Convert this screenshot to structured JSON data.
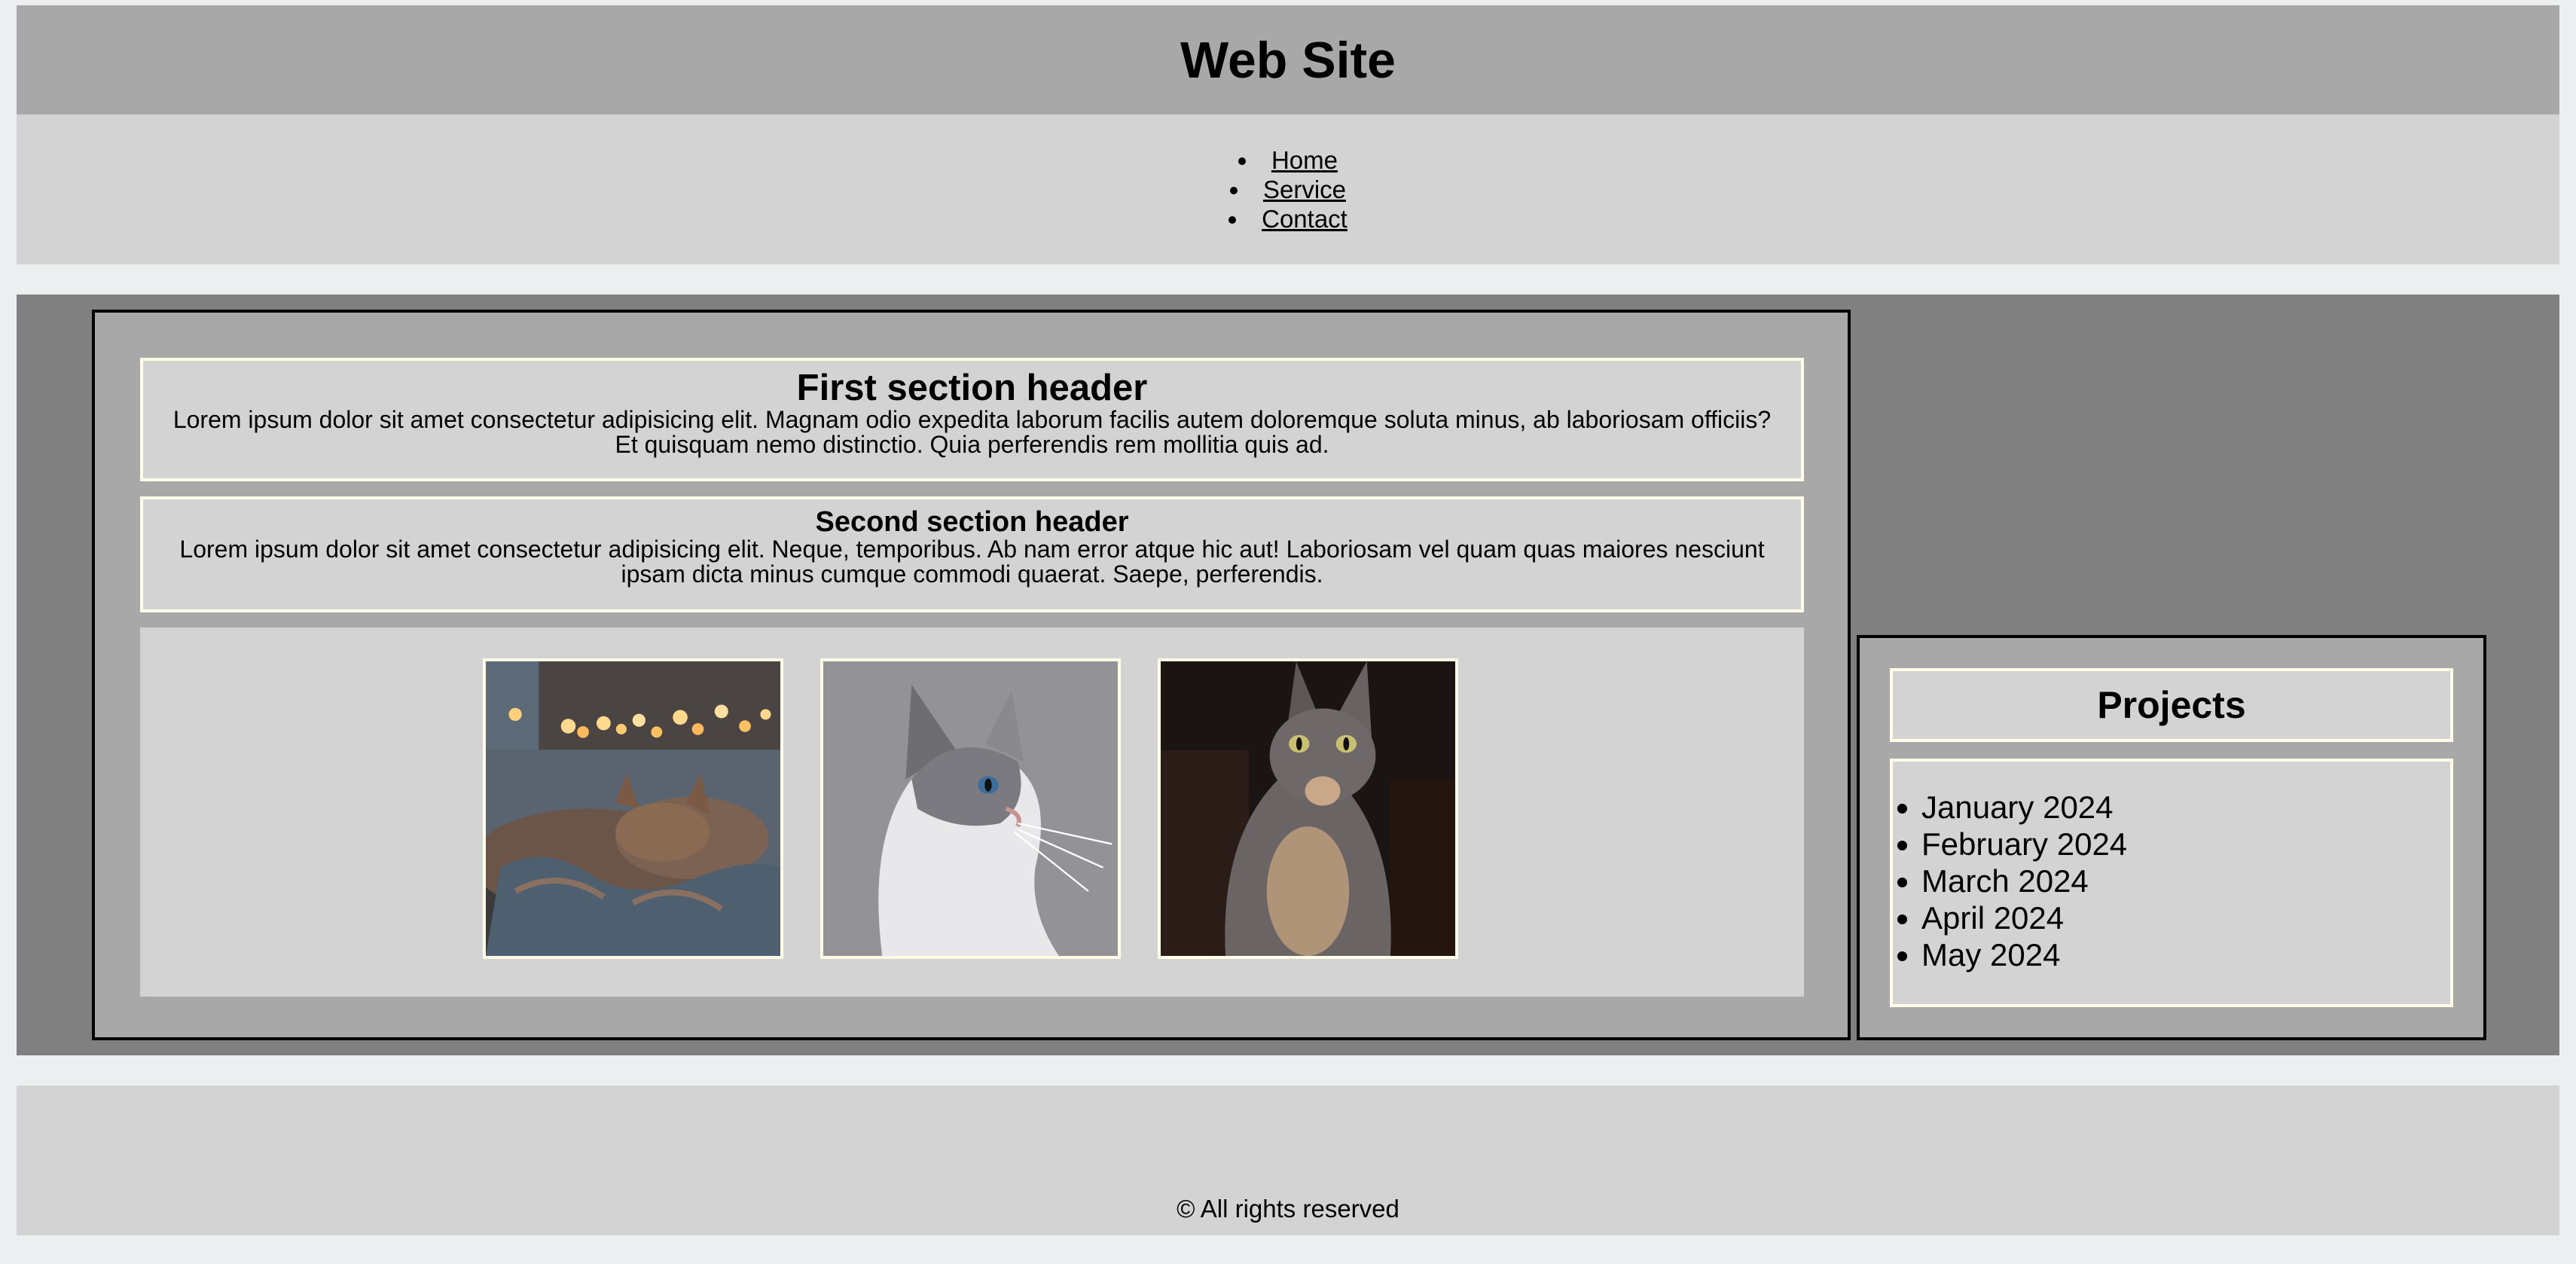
{
  "site": {
    "title": "Web Site"
  },
  "nav": {
    "items": [
      {
        "label": "Home"
      },
      {
        "label": "Service"
      },
      {
        "label": "Contact"
      }
    ]
  },
  "sections": [
    {
      "header": "First section header",
      "body": "Lorem ipsum dolor sit amet consectetur adipisicing elit. Magnam odio expedita laborum facilis autem doloremque soluta minus, ab laboriosam officiis? Et quisquam nemo distinctio. Quia perferendis rem mollitia quis ad."
    },
    {
      "header": "Second section header",
      "body": "Lorem ipsum dolor sit amet consectetur adipisicing elit. Neque, temporibus. Ab nam error atque hic aut! Laboriosam vel quam quas maiores nesciunt ipsam dicta minus cumque commodi quaerat. Saepe, perferendis."
    }
  ],
  "gallery": {
    "images": [
      {
        "icon": "cat-sleeping-photo"
      },
      {
        "icon": "cat-profile-photo"
      },
      {
        "icon": "cat-portrait-photo"
      }
    ]
  },
  "aside": {
    "title": "Projects",
    "months": [
      "January 2024",
      "February 2024",
      "March 2024",
      "April 2024",
      "May 2024"
    ]
  },
  "footer": {
    "text": "© All rights reserved"
  }
}
